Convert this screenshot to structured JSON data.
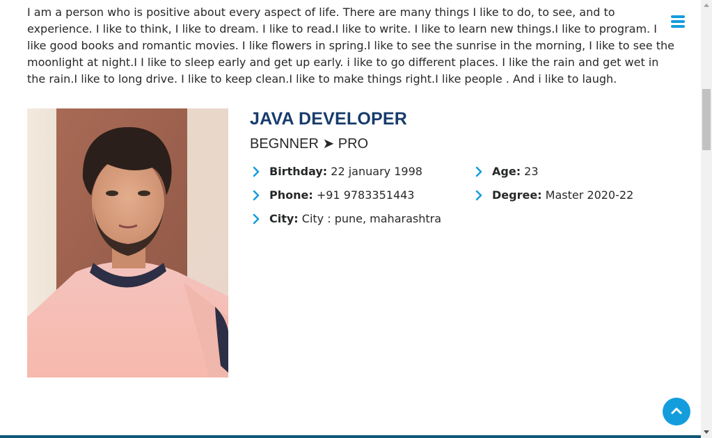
{
  "about": {
    "intro": "I am a person who is positive about every aspect of life. There are many things I like to do, to see, and to experience. I like to think, I like to dream. I like to read.I like to write. I like to learn new things.I like to program. I like good books and romantic movies. I like flowers in spring.I like to see the sunrise in the morning, I like to see the moonlight at night.I I like to sleep early and get up early. i like to go different places. I like the rain and get wet in the rain.I like to long drive. I like to keep clean.I like to make things right.I like people . And i like to laugh.",
    "title": "JAVA DEVELOPER",
    "subtitle": "BEGNNER ➤ PRO",
    "details": {
      "birthday": {
        "label": "Birthday:",
        "value": " 22 january 1998"
      },
      "age": {
        "label": "Age:",
        "value": " 23"
      },
      "phone": {
        "label": "Phone:",
        "value": " +91 9783351443"
      },
      "degree": {
        "label": "Degree:",
        "value": " Master 2020-22"
      },
      "city": {
        "label": "City:",
        "value": " City : pune, maharashtra"
      }
    }
  },
  "icons": {
    "menu": "hamburger-icon",
    "back_to_top": "chevron-up-icon",
    "detail_bullet": "chevron-right-icon"
  },
  "colors": {
    "accent": "#149ddd",
    "heading": "#173b6c",
    "text": "#272829"
  }
}
